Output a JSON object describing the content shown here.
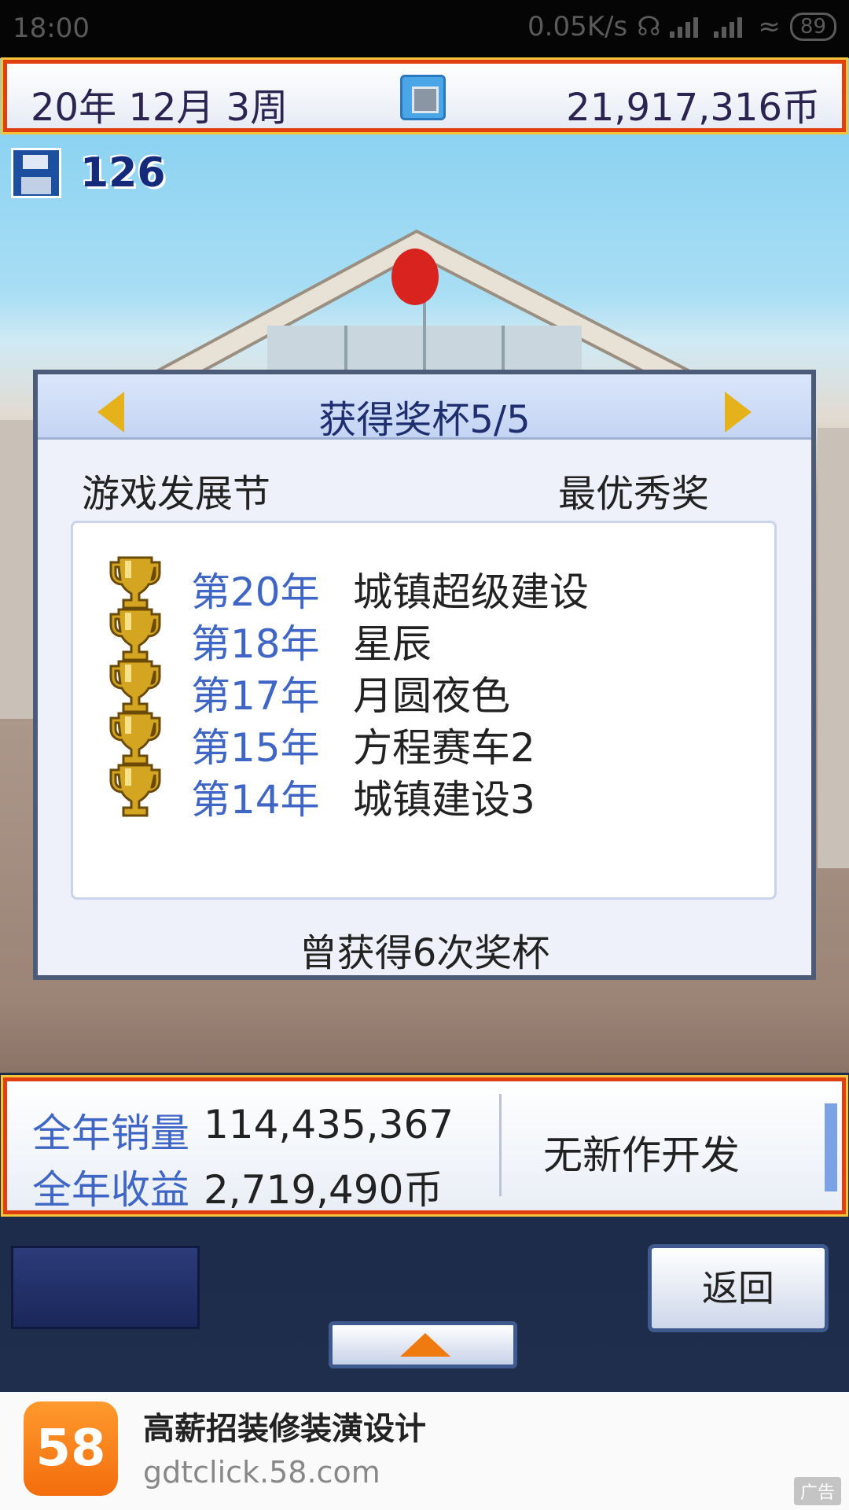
{
  "status_bar": {
    "time": "18:00",
    "network_speed": "0.05K/s",
    "battery": "89"
  },
  "top_bar": {
    "date": "20年 12月 3周",
    "money": "21,917,316币"
  },
  "save": {
    "count": "126"
  },
  "dialog": {
    "title": "获得奖杯5/5",
    "festival": "游戏发展节",
    "award": "最优秀奖",
    "awards": [
      {
        "year": "第20年",
        "game": "城镇超级建设"
      },
      {
        "year": "第18年",
        "game": "星辰"
      },
      {
        "year": "第17年",
        "game": "月圆夜色"
      },
      {
        "year": "第15年",
        "game": "方程赛车2"
      },
      {
        "year": "第14年",
        "game": "城镇建设3"
      }
    ],
    "total": "曾获得6次奖杯"
  },
  "stats": {
    "sales_label": "全年销量",
    "sales_value": "114,435,367",
    "revenue_label": "全年收益",
    "revenue_value": "2,719,490币",
    "dev_status": "无新作开发"
  },
  "controls": {
    "back_label": "返回"
  },
  "ad": {
    "logo_text": "58",
    "headline": "高薪招装修装潢设计",
    "domain": "gdtclick.58.com",
    "tag": "广告"
  },
  "colors": {
    "frame_red": "#e04010",
    "frame_gold": "#f6c23a",
    "year_blue": "#3f66c4",
    "title_navy": "#1e2e6e",
    "trophy_gold": "#d4a520",
    "ad_orange": "#f36d0c"
  }
}
